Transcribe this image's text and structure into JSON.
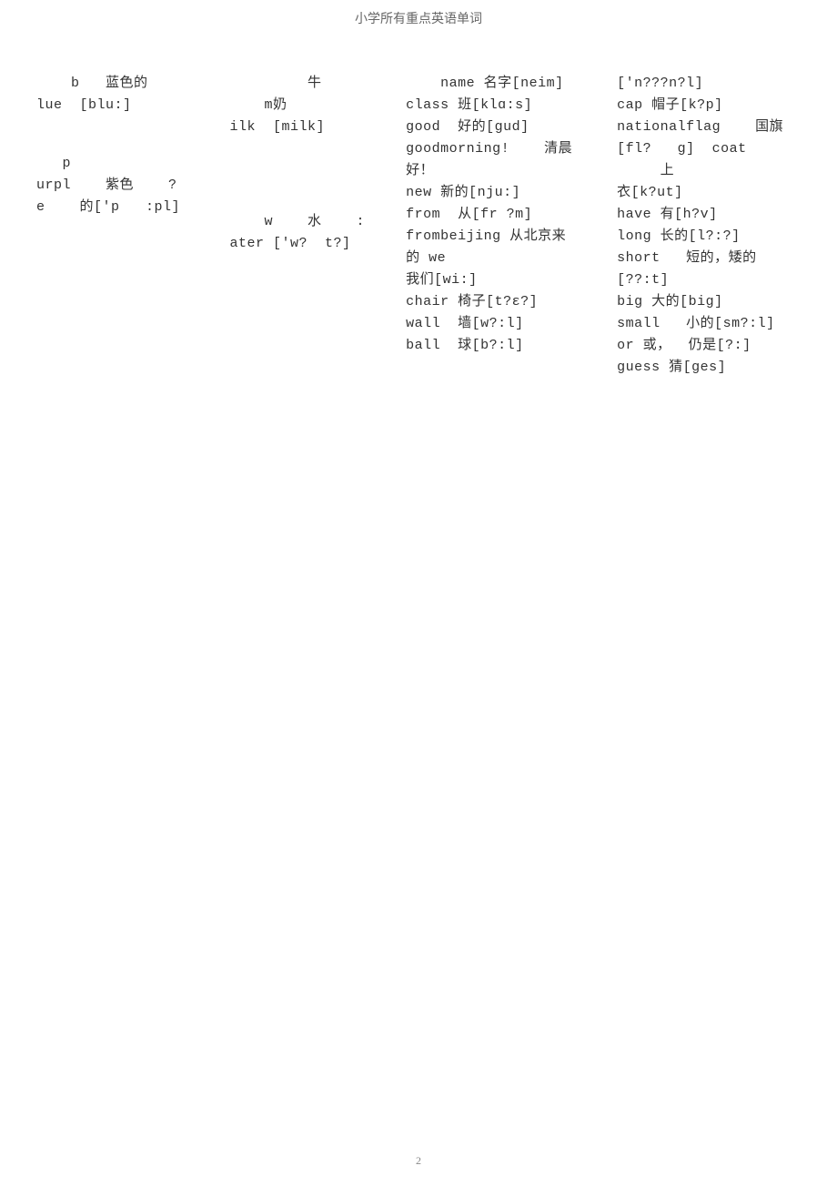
{
  "header": {
    "title": "小学所有重点英语单词"
  },
  "col1": {
    "block1": {
      "l1": "    b   蓝色的",
      "l2": "lue  [blu:]"
    },
    "block2": {
      "l1": "   p",
      "l2": "urpl    紫色    ?",
      "l3": "e    的['p   :pl]"
    }
  },
  "col2": {
    "block1": {
      "l1": "           牛",
      "l2": "      m奶",
      "l3": "  ilk  [milk]"
    },
    "block2": {
      "l1": "      w    水    :",
      "l2": "  ater ['w?  t?]"
    }
  },
  "col3": {
    "l1": "    name 名字[neim]",
    "l2": "class 班[klɑ:s]",
    "l3": "good  好的[gud]",
    "l4": "goodmorning!    清晨",
    "l5": "好！",
    "l6": "new 新的[nju:]",
    "l7": "from  从[fr ?m]",
    "l8": "frombeijing 从北京来",
    "l9": "的 we",
    "l10": "我们[wi:]",
    "l11": "chair 椅子[t?ε?]",
    "l12": "wall  墙[w?:l]",
    "l13": "ball  球[b?:l]"
  },
  "col4": {
    "l1": "['n???n?l]",
    "l2": "cap 帽子[k?p]",
    "l3": "nationalflag    国旗",
    "l4": "[fl?   g]  coat",
    "l5": "     上",
    "l6": "衣[k?ut]",
    "l7": "have 有[h?v]",
    "l8": "long 长的[l?:?]",
    "l9": "short   短的，矮的",
    "l10": "[??:t]",
    "l11": "big 大的[big]",
    "l12": "small   小的[sm?:l]",
    "l13": "or 或，  仍是[?:]",
    "l14": "guess 猜[ges]"
  },
  "footer": {
    "page": "2"
  }
}
